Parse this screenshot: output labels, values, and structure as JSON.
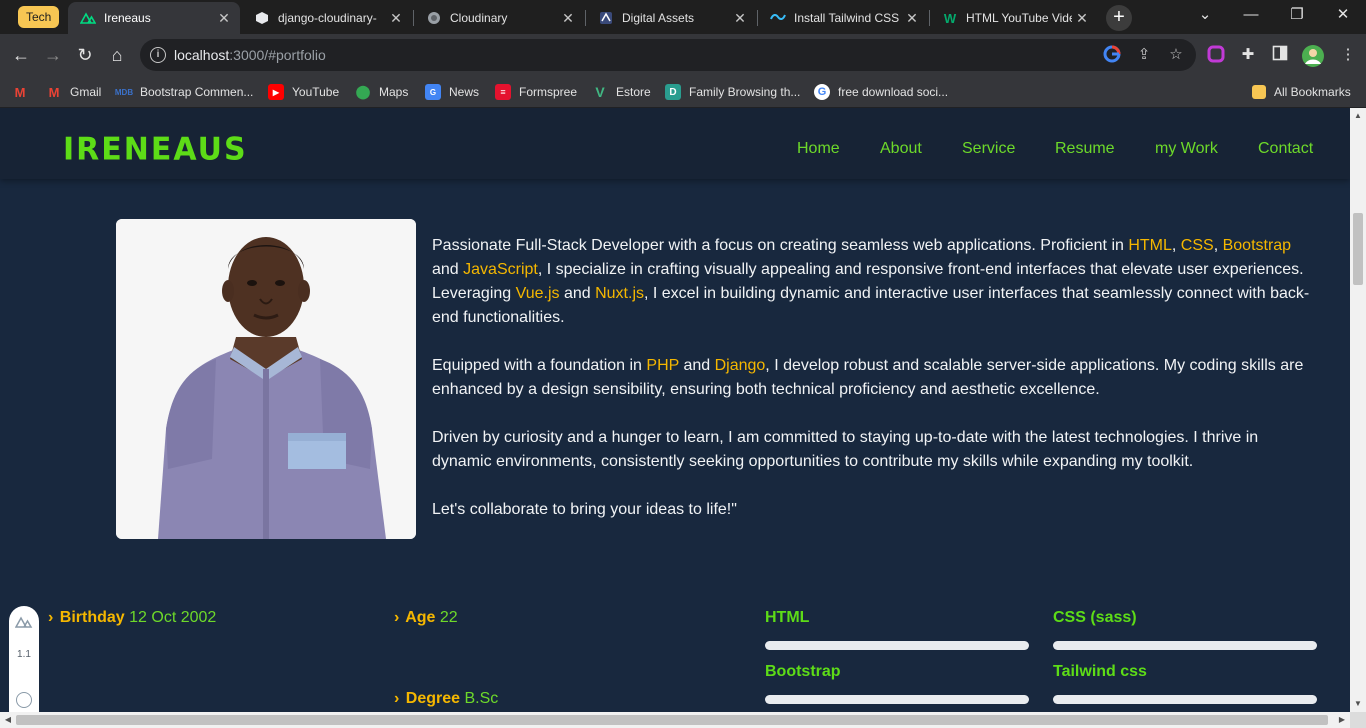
{
  "browser": {
    "group_chip": "Tech",
    "tabs": [
      {
        "title": "Ireneaus",
        "icon": "nuxt-icon",
        "active": true
      },
      {
        "title": "django-cloudinary-",
        "icon": "cube-icon",
        "active": false
      },
      {
        "title": "Cloudinary",
        "icon": "globe-icon",
        "active": false
      },
      {
        "title": "Digital Assets",
        "icon": "digital-assets-icon",
        "active": false
      },
      {
        "title": "Install Tailwind CSS",
        "icon": "tailwind-icon",
        "active": false
      },
      {
        "title": "HTML YouTube Vide",
        "icon": "w3schools-icon",
        "active": false
      }
    ],
    "url_host": "localhost",
    "url_rest": ":3000/#portfolio",
    "bookmarks": [
      {
        "label": "Gmail",
        "icon": "gmail-icon"
      },
      {
        "label": "Bootstrap Commen...",
        "icon": "mdb-icon"
      },
      {
        "label": "YouTube",
        "icon": "youtube-icon"
      },
      {
        "label": "Maps",
        "icon": "maps-icon"
      },
      {
        "label": "News",
        "icon": "news-icon"
      },
      {
        "label": "Formspree",
        "icon": "formspree-icon"
      },
      {
        "label": "Estore",
        "icon": "vue-icon"
      },
      {
        "label": "Family Browsing th...",
        "icon": "d-icon"
      },
      {
        "label": "free download soci...",
        "icon": "google-icon"
      },
      {
        "label": "All Bookmarks",
        "icon": "folder-icon"
      }
    ]
  },
  "site": {
    "logo": "IRENEAUS",
    "nav": [
      "Home",
      "About",
      "Service",
      "Resume",
      "my Work",
      "Contact"
    ],
    "bio": {
      "p1": [
        {
          "t": "Passionate Full-Stack Developer with a focus on creating seamless web applications. Proficient in ",
          "h": false
        },
        {
          "t": "HTML",
          "h": true
        },
        {
          "t": ", ",
          "h": false
        },
        {
          "t": "CSS",
          "h": true
        },
        {
          "t": ", ",
          "h": false
        },
        {
          "t": "Bootstrap",
          "h": true
        },
        {
          "t": " and ",
          "h": false
        },
        {
          "t": "JavaScript",
          "h": true
        },
        {
          "t": ", I specialize in crafting visually appealing and responsive front-end interfaces that elevate user experiences. Leveraging ",
          "h": false
        },
        {
          "t": "Vue.js",
          "h": true
        },
        {
          "t": " and ",
          "h": false
        },
        {
          "t": "Nuxt.js",
          "h": true
        },
        {
          "t": ", I excel in building dynamic and interactive user interfaces that seamlessly connect with back-end functionalities.",
          "h": false
        }
      ],
      "p2": [
        {
          "t": "Equipped with a foundation in ",
          "h": false
        },
        {
          "t": "PHP",
          "h": true
        },
        {
          "t": " and ",
          "h": false
        },
        {
          "t": "Django",
          "h": true
        },
        {
          "t": ", I develop robust and scalable server-side applications. My coding skills are enhanced by a design sensibility, ensuring both technical proficiency and aesthetic excellence.",
          "h": false
        }
      ],
      "p3": "Driven by curiosity and a hunger to learn, I am committed to staying up-to-date with the latest technologies. I thrive in dynamic environments, consistently seeking opportunities to contribute my skills while expanding my toolkit.",
      "p4": "Let's collaborate to bring your ideas to life!\""
    },
    "facts": {
      "birthday_label": "Birthday",
      "birthday": "12 Oct 2002",
      "age_label": "Age",
      "age": "22",
      "degree_label": "Degree",
      "degree": "B.Sc"
    },
    "skills": [
      {
        "name": "HTML",
        "level": 1.0
      },
      {
        "name": "CSS (sass)",
        "level": 1.0
      },
      {
        "name": "Bootstrap",
        "level": 1.0
      },
      {
        "name": "Tailwind css",
        "level": 1.0
      }
    ],
    "dev_pill_text": "1.1"
  },
  "colors": {
    "page_bg": "#18283e",
    "header_bg": "#172335",
    "accent_green": "#5ddc17",
    "highlight_yellow": "#f5b700"
  }
}
